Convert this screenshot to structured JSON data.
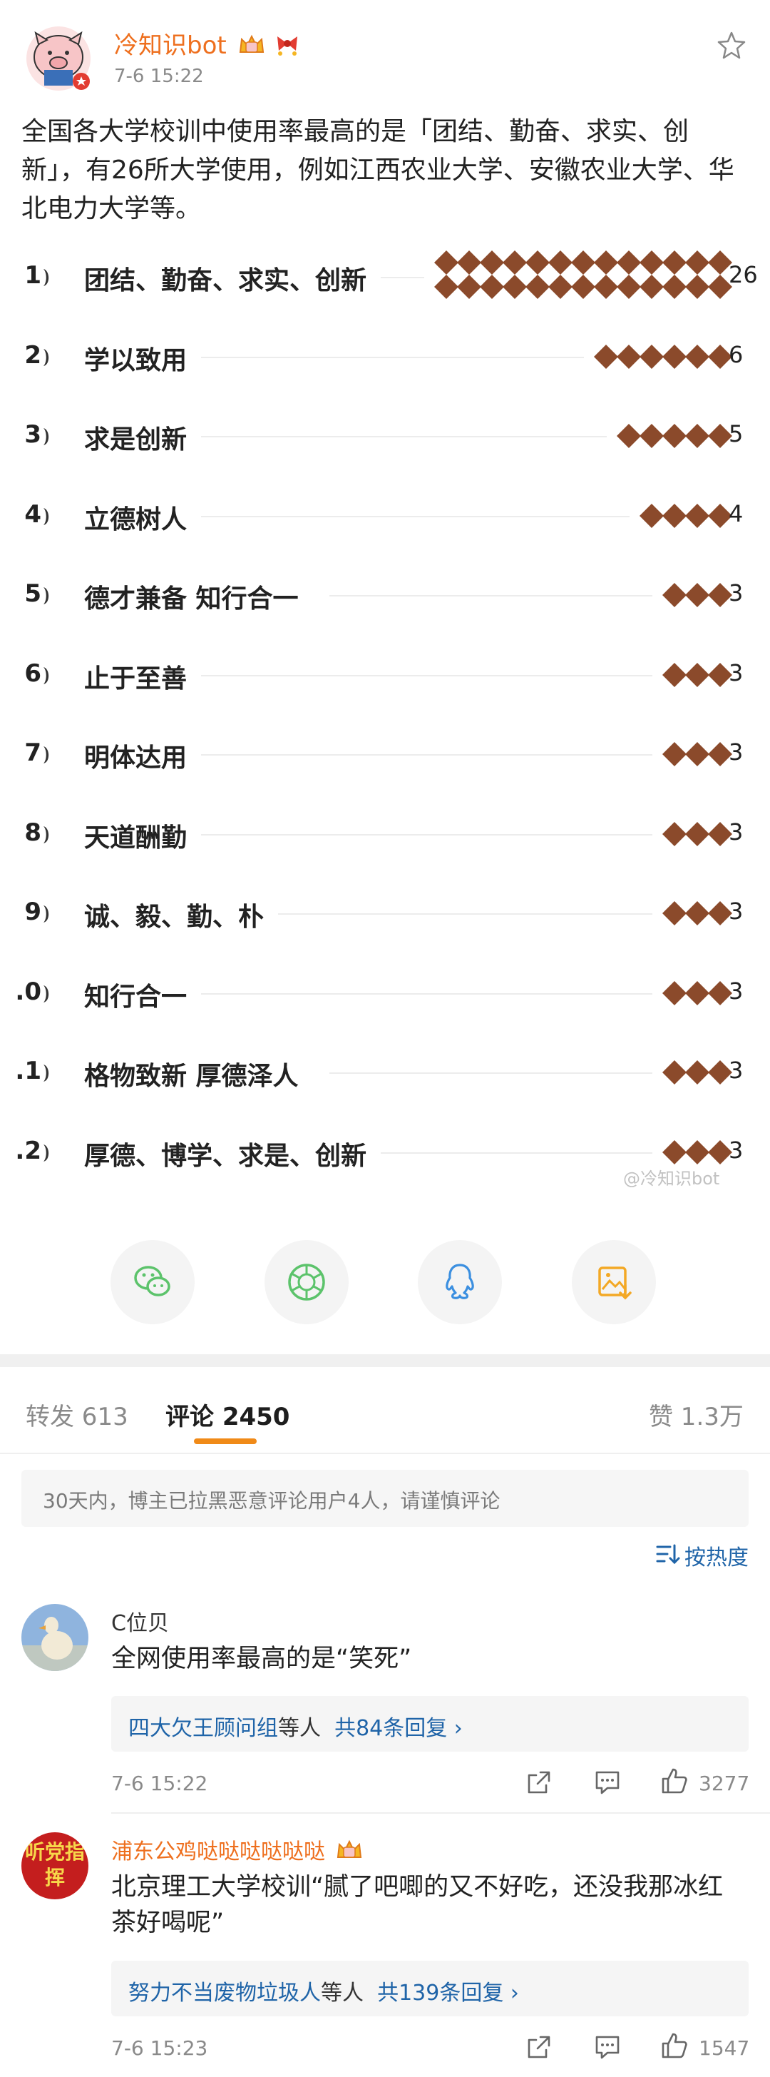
{
  "post": {
    "author": "冷知识bot",
    "time": "7-6 15:22",
    "text": "全国各大学校训中使用率最高的是「团结、勤奋、求实、创新」，有26所大学使用，例如江西农业大学、安徽农业大学、华北电力大学等。",
    "watermark": "@冷知识bot"
  },
  "ranking": [
    {
      "num": "1",
      "label": "团结、勤奋、求实、创新",
      "value": 26,
      "value_text": "26"
    },
    {
      "num": "2",
      "label": "学以致用",
      "value": 6,
      "value_text": "6"
    },
    {
      "num": "3",
      "label": "求是创新",
      "value": 5,
      "value_text": "5"
    },
    {
      "num": "4",
      "label": "立德树人",
      "value": 4,
      "value_text": "4"
    },
    {
      "num": "5",
      "label": "德才兼备 知行合一",
      "value": 3,
      "value_text": "3"
    },
    {
      "num": "6",
      "label": "止于至善",
      "value": 3,
      "value_text": "3"
    },
    {
      "num": "7",
      "label": "明体达用",
      "value": 3,
      "value_text": "3"
    },
    {
      "num": "8",
      "label": "天道酬勤",
      "value": 3,
      "value_text": "3"
    },
    {
      "num": "9",
      "label": "诚、毅、勤、朴",
      "value": 3,
      "value_text": "3"
    },
    {
      "num": ".0",
      "label": "知行合一",
      "value": 3,
      "value_text": "3"
    },
    {
      "num": ".1",
      "label": "格物致新 厚德泽人",
      "value": 3,
      "value_text": "3"
    },
    {
      "num": ".2",
      "label": "厚德、博学、求是、创新",
      "value": 3,
      "value_text": "3"
    }
  ],
  "share": [
    "wechat-icon",
    "moments-icon",
    "qq-icon",
    "save-image-icon"
  ],
  "tabs": {
    "repost": "转发 613",
    "comment": "评论 2450",
    "like": "赞 1.3万"
  },
  "notice": "30天内，博主已拉黑恶意评论用户4人，请谨慎评论",
  "sort_label": "按热度",
  "comments": [
    {
      "name": "C位贝",
      "text": "全网使用率最高的是“笑死”",
      "reply_users": "四大欠王顾问组",
      "reply_rest": "等人",
      "reply_count": "共84条回复 ›",
      "time": "7-6 15:22",
      "likes": "3277"
    },
    {
      "name": "浦东公鸡哒哒哒哒哒哒",
      "avatar_text": "听党指挥",
      "text": "北京理工大学校训“腻了吧唧的又不好吃，还没我那冰红茶好喝呢”",
      "reply_users": "努力不当废物垃圾人",
      "reply_rest": "等人",
      "reply_count": "共139条回复 ›",
      "time": "7-6 15:23",
      "likes": "1547"
    }
  ],
  "colors": {
    "diamond": "#8b4a2b",
    "accent": "#ee6f1e",
    "link": "#1f64a8",
    "tab_underline": "#f08a18",
    "share_green": "#5cc36b",
    "share_blue": "#3b8fe0",
    "share_orange": "#f3a825"
  }
}
